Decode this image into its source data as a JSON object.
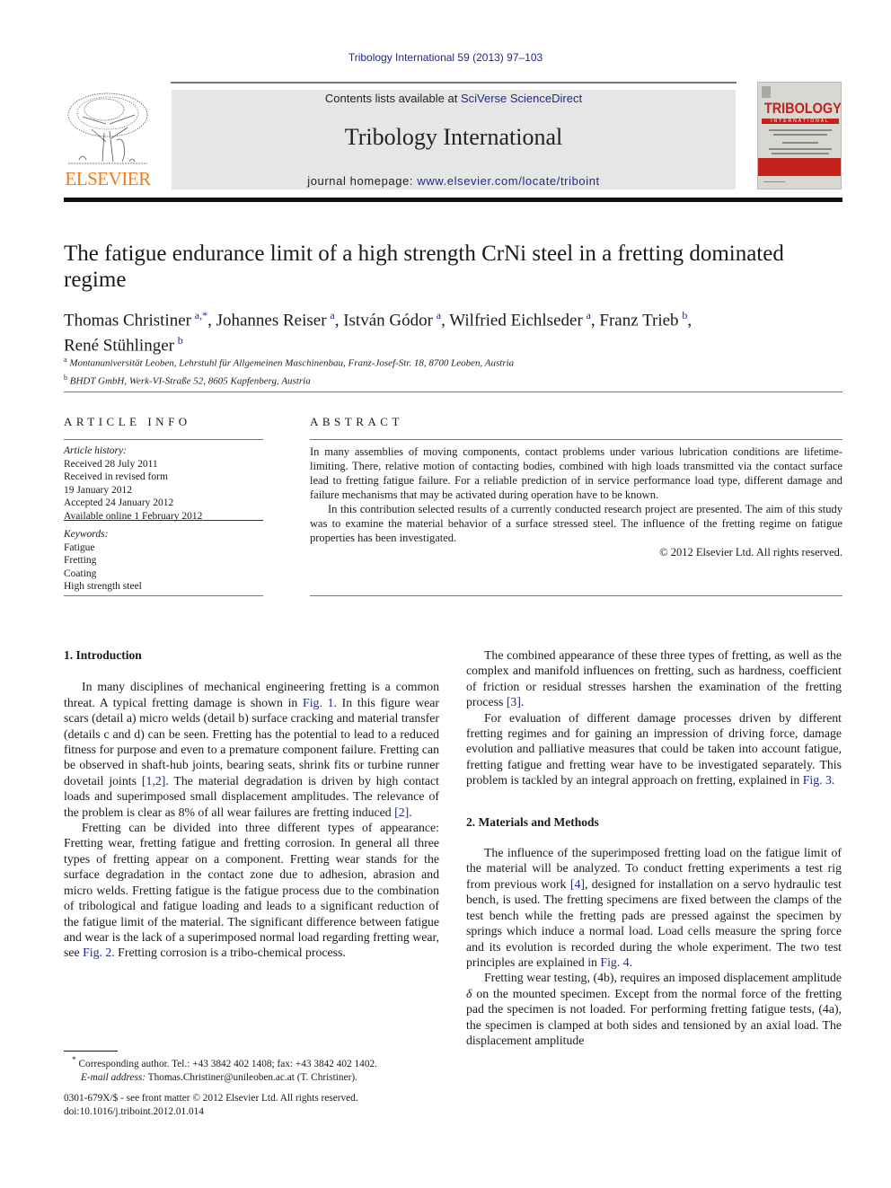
{
  "header": {
    "journal_ref": "Tribology International 59 (2013) 97–103",
    "contents_prefix": "Contents lists available at ",
    "contents_link": "SciVerse ScienceDirect",
    "journal_title": "Tribology International",
    "homepage_prefix": "journal homepage: ",
    "homepage_link": "www.elsevier.com/locate/triboint",
    "publisher_logo_text": "ELSEVIER",
    "cover_title": "TRIBOLOGY",
    "cover_subtitle": "INTERNATIONAL"
  },
  "article": {
    "title": "The fatigue endurance limit of a high strength CrNi steel in a fretting dominated regime",
    "authors": [
      {
        "name": "Thomas Christiner",
        "sup": "a,*",
        "sep": ", "
      },
      {
        "name": "Johannes Reiser",
        "sup": "a",
        "sep": ", "
      },
      {
        "name": "István Gódor",
        "sup": "a",
        "sep": ", "
      },
      {
        "name": "Wilfried Eichlseder",
        "sup": "a",
        "sep": ", "
      },
      {
        "name": "Franz Trieb",
        "sup": "b",
        "sep": ","
      },
      {
        "name": "René Stühlinger",
        "sup": "b",
        "sep": ""
      }
    ],
    "affiliations": [
      {
        "sup": "a",
        "text": "Montanuniversität Leoben, Lehrstuhl für Allgemeinen Maschinenbau, Franz-Josef-Str. 18, 8700 Leoben, Austria"
      },
      {
        "sup": "b",
        "text": "BHDT GmbH, Werk-VI-Straße 52, 8605 Kapfenberg, Austria"
      }
    ]
  },
  "article_info": {
    "heading": "ARTICLE INFO",
    "history_label": "Article history:",
    "history": [
      "Received 28 July 2011",
      "Received in revised form",
      "19 January 2012",
      "Accepted 24 January 2012",
      "Available online 1 February 2012"
    ],
    "keywords_label": "Keywords:",
    "keywords": [
      "Fatigue",
      "Fretting",
      "Coating",
      "High strength steel"
    ]
  },
  "abstract": {
    "heading": "ABSTRACT",
    "p1": "In many assemblies of moving components, contact problems under various lubrication conditions are lifetime-limiting. There, relative motion of contacting bodies, combined with high loads transmitted via the contact surface lead to fretting fatigue failure. For a reliable prediction of in service performance load type, different damage and failure mechanisms that may be activated during operation have to be known.",
    "p2": "In this contribution selected results of a currently conducted research project are presented. The aim of this study was to examine the material behavior of a surface stressed steel. The influence of the fretting regime on fatigue properties has been investigated.",
    "copyright": "© 2012 Elsevier Ltd. All rights reserved."
  },
  "body": {
    "s1_heading": "1.  Introduction",
    "s1_p1": [
      {
        "t": "In many disciplines of mechanical engineering fretting is a common threat. A typical fretting damage is shown in "
      },
      {
        "t": "Fig. 1",
        "link": true
      },
      {
        "t": ". In this figure wear scars (detail a) micro welds (detail b) surface cracking and material transfer (details c and d) can be seen. Fretting has the potential to lead to a reduced fitness for purpose and even to a premature component failure. Fretting can be observed in shaft-hub joints, bearing seats, shrink fits or turbine runner dovetail joints "
      },
      {
        "t": "[1,2]",
        "link": true
      },
      {
        "t": ". The material degradation is driven by high contact loads and superimposed small displacement amplitudes. The relevance of the problem is clear as 8% of all wear failures are fretting induced "
      },
      {
        "t": "[2]",
        "link": true
      },
      {
        "t": "."
      }
    ],
    "s1_p2": [
      {
        "t": "Fretting can be divided into three different types of appearance: Fretting wear, fretting fatigue and fretting corrosion. In general all three types of fretting appear on a component. Fretting wear stands for the surface degradation in the contact zone due to adhesion, abrasion and micro welds. Fretting fatigue is the fatigue process due to the combination of tribological and fatigue loading and leads to a significant reduction of the fatigue limit of the material. The significant difference between fatigue and wear is the lack of a superimposed normal load regarding fretting wear, see "
      },
      {
        "t": "Fig. 2",
        "link": true
      },
      {
        "t": ". Fretting corrosion is a tribo-chemical process."
      }
    ],
    "s1_p3": [
      {
        "t": "The combined appearance of these three types of fretting, as well as the complex and manifold influences on fretting, such as hardness, coefficient of friction or residual stresses harshen the examination of the fretting process "
      },
      {
        "t": "[3]",
        "link": true
      },
      {
        "t": "."
      }
    ],
    "s1_p4": [
      {
        "t": "For evaluation of different damage processes driven by different fretting regimes and for gaining an impression of driving force, damage evolution and palliative measures that could be taken into account fatigue, fretting fatigue and fretting wear have to be investigated separately. This problem is tackled by an integral approach on fretting, explained in "
      },
      {
        "t": "Fig. 3",
        "link": true
      },
      {
        "t": "."
      }
    ],
    "s2_heading": "2.  Materials and Methods",
    "s2_p1": [
      {
        "t": "The influence of the superimposed fretting load on the fatigue limit of the material will be analyzed. To conduct fretting experiments a test rig from previous work "
      },
      {
        "t": "[4]",
        "link": true
      },
      {
        "t": ", designed for installation on a servo hydraulic test bench, is used. The fretting specimens are fixed between the clamps of the test bench while the fretting pads are pressed against the specimen by springs which induce a normal load. Load cells measure the spring force and its evolution is recorded during the whole experiment. The two test principles are explained in "
      },
      {
        "t": "Fig. 4",
        "link": true
      },
      {
        "t": "."
      }
    ],
    "s2_p2": [
      {
        "t": "Fretting wear testing, (4b), requires an imposed displacement amplitude "
      },
      {
        "t": "δ",
        "italic": true
      },
      {
        "t": " on the mounted specimen. Except from the normal force of the fretting pad the specimen is not loaded. For performing fretting fatigue tests, (4a), the specimen is clamped at both sides and tensioned by an axial load. The displacement amplitude"
      }
    ]
  },
  "footnote": {
    "marker": "*",
    "corresponding": " Corresponding author. Tel.: +43 3842 402 1408; fax: +43 3842 402 1402.",
    "email_label": "E-mail address:",
    "email": " Thomas.Christiner@unileoben.ac.at (T. Christiner)."
  },
  "front_matter": {
    "issn": "0301-679X/$ - see front matter © 2012 Elsevier Ltd. All rights reserved.",
    "doi": "doi:10.1016/j.triboint.2012.01.014"
  },
  "colors": {
    "link": "#1f2a8a",
    "elsevier_orange": "#f07d1a",
    "cover_red": "#c4201c",
    "banner_gray": "#e6e6e6"
  }
}
